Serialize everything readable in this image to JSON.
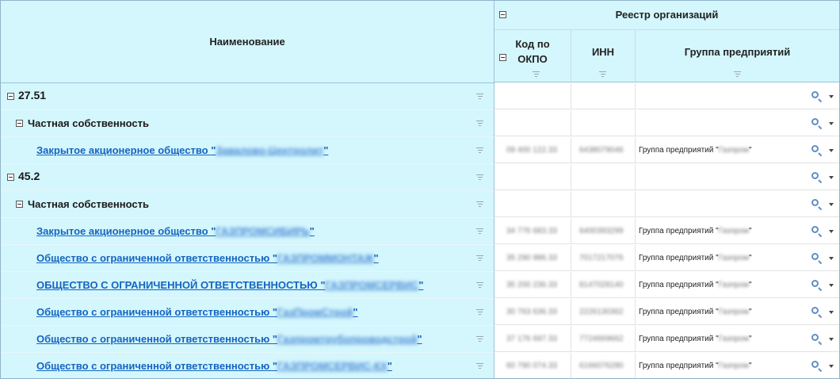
{
  "header": {
    "name_col": "Наименование",
    "group_title": "Реестр организаций",
    "okpo_label_line1": "Код по",
    "okpo_label_line2": "ОКПО",
    "inn_label": "ИНН",
    "group_label": "Группа предприятий"
  },
  "rows": [
    {
      "level": 0,
      "name": "27.51"
    },
    {
      "level": 1,
      "name": "Частная собственность"
    },
    {
      "level": 2,
      "name_prefix": "Закрытое акционерное общество \"",
      "name_blurred": "Завалово-Центролит",
      "name_suffix": "\"",
      "okpo": "09 400 122.33",
      "inn": "6438079046",
      "group_prefix": "Группа предприятий \"",
      "group_blurred": "Газпром",
      "group_suffix": "\""
    },
    {
      "level": 0,
      "name": "45.2"
    },
    {
      "level": 1,
      "name": "Частная собственность"
    },
    {
      "level": 2,
      "name_prefix": "Закрытое акционерное общество \"",
      "name_blurred": "ГАЗПРОМСИБИРЬ",
      "name_suffix": "\"",
      "okpo": "34 776 683.33",
      "inn": "6400393299",
      "group_prefix": "Группа предприятий \"",
      "group_blurred": "Газпром",
      "group_suffix": "\""
    },
    {
      "level": 2,
      "name_prefix": "Общество с ограниченной ответственностью \"",
      "name_blurred": "ГАЗПРОММОНТАЖ",
      "name_suffix": "\"",
      "okpo": "35 290 986.33",
      "inn": "7017217076",
      "group_prefix": "Группа предприятий \"",
      "group_blurred": "Газпром",
      "group_suffix": "\""
    },
    {
      "level": 2,
      "name_prefix": "ОБЩЕСТВО С ОГРАНИЧЕННОЙ ОТВЕТСТВЕННОСТЬЮ \"",
      "name_blurred": "ГАЗПРОМСЕРВИС",
      "name_suffix": "\"",
      "okpo": "35 200 236.33",
      "inn": "8147028140",
      "group_prefix": "Группа предприятий \"",
      "group_blurred": "Газпром",
      "group_suffix": "\""
    },
    {
      "level": 2,
      "name_prefix": "Общество с ограниченной ответственностью \"",
      "name_blurred": "ГазПромСтрой",
      "name_suffix": "\"",
      "okpo": "30 763 636.33",
      "inn": "2226130362",
      "group_prefix": "Группа предприятий \"",
      "group_blurred": "Газпром",
      "group_suffix": "\""
    },
    {
      "level": 2,
      "name_prefix": "Общество с ограниченной ответственностью \"",
      "name_blurred": "Газпромтрубопроводстрой",
      "name_suffix": "\"",
      "okpo": "37 176 697.33",
      "inn": "7724669662",
      "group_prefix": "Группа предприятий \"",
      "group_blurred": "Газпром",
      "group_suffix": "\""
    },
    {
      "level": 2,
      "name_prefix": "Общество с ограниченной ответственностью \"",
      "name_blurred": "ГАЗПРОМСЕРВИС-КХ",
      "name_suffix": "\"",
      "okpo": "60 790 074.33",
      "inn": "6166076280",
      "group_prefix": "Группа предприятий \"",
      "group_blurred": "Газпром",
      "group_suffix": "\""
    }
  ]
}
